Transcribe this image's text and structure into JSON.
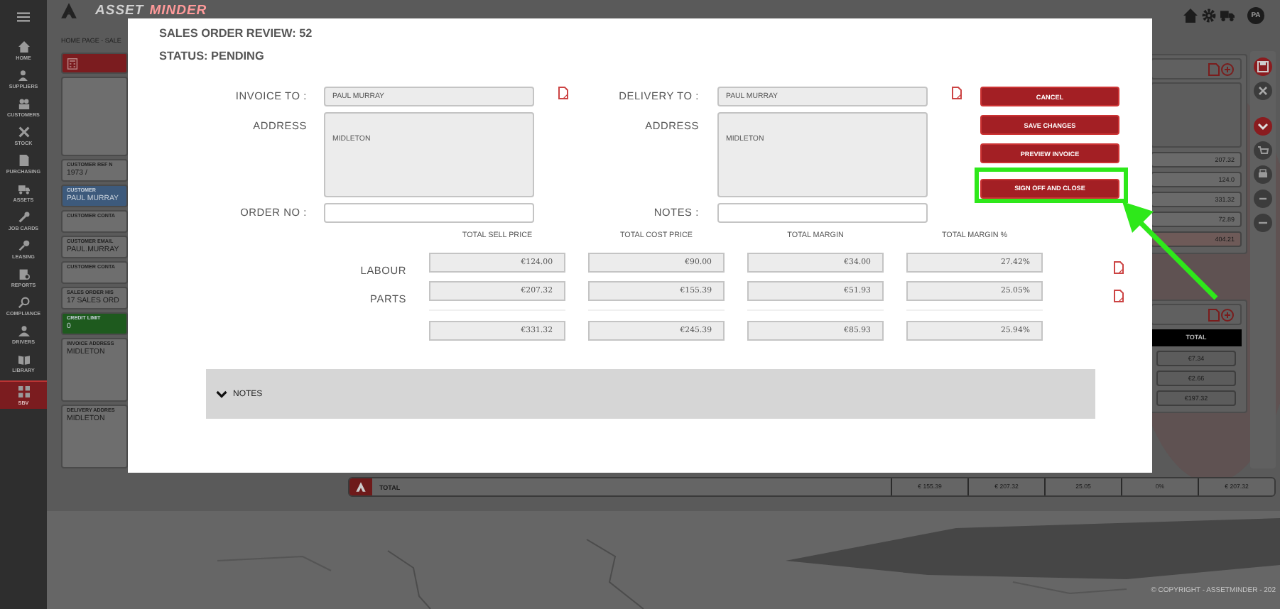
{
  "sidebar": {
    "items": [
      {
        "label": "HOME",
        "selected": false
      },
      {
        "label": "SUPPLIERS",
        "selected": false
      },
      {
        "label": "CUSTOMERS",
        "selected": false
      },
      {
        "label": "STOCK",
        "selected": false
      },
      {
        "label": "PURCHASING",
        "selected": false
      },
      {
        "label": "ASSETS",
        "selected": false
      },
      {
        "label": "JOB CARDS",
        "selected": false
      },
      {
        "label": "LEASING",
        "selected": false
      },
      {
        "label": "REPORTS",
        "selected": false
      },
      {
        "label": "COMPLIANCE",
        "selected": false
      },
      {
        "label": "DRIVERS",
        "selected": false
      },
      {
        "label": "LIBRARY",
        "selected": false
      },
      {
        "label": "SBV",
        "selected": true
      }
    ]
  },
  "header": {
    "logo_first": "ASSET",
    "logo_second": "MINDER",
    "user_initials": "PA"
  },
  "breadcrumb": "HOME PAGE - SALE",
  "customer_panel": {
    "cards": [
      {
        "kind": "icon",
        "color": "#7b1c1f"
      },
      {
        "kind": "blank",
        "color": "#6e6e6e"
      },
      {
        "kind": "field",
        "label": "CUSTOMER REF N",
        "value": "1973 /",
        "color": "#6e6e6e"
      },
      {
        "kind": "field",
        "label": "CUSTOMER",
        "value": "PAUL MURRAY",
        "color": "#3d5a7c"
      },
      {
        "kind": "field",
        "label": "CUSTOMER CONTA",
        "color": "#6e6e6e"
      },
      {
        "kind": "field",
        "label": "CUSTOMER EMAIL",
        "value": "PAUL.MURRAY",
        "color": "#6e6e6e"
      },
      {
        "kind": "field",
        "label": "CUSTOMER CONTA",
        "color": "#6e6e6e"
      },
      {
        "kind": "field",
        "label": "SALES ORDER HIS",
        "value": "17 SALES ORD",
        "color": "#6e6e6e"
      },
      {
        "kind": "field",
        "label": "CREDIT LIMIT",
        "value": "0",
        "color": "#1e5a1e"
      },
      {
        "kind": "address",
        "label": "INVOICE ADDRESS",
        "value": "MIDLETON",
        "color": "#6e6e6e"
      },
      {
        "kind": "address",
        "label": "DELIVERY ADDRES",
        "value": "MIDLETON",
        "color": "#6e6e6e"
      }
    ]
  },
  "summary_panel": {
    "values": [
      {
        "text": "207.32",
        "highlighted": false
      },
      {
        "text": "124.0",
        "highlighted": false
      },
      {
        "text": "331.32",
        "highlighted": false
      },
      {
        "text": "72.89",
        "highlighted": false
      },
      {
        "text": "404.21",
        "highlighted": true
      }
    ]
  },
  "lines_panel": {
    "column": "TOTAL",
    "values": [
      "€7.34",
      "€2.66",
      "€197.32"
    ]
  },
  "total_bar": {
    "label": "TOTAL",
    "values": [
      "€ 155.39",
      "€ 207.32",
      "25.05",
      "0%",
      "€ 207.32"
    ]
  },
  "copyright": "© COPYRIGHT - ASSETMINDER - 202",
  "modal": {
    "title": "SALES ORDER REVIEW: 52",
    "status": "STATUS: PENDING",
    "invoice_to": {
      "label": "INVOICE TO :",
      "value": "PAUL MURRAY"
    },
    "invoice_address": {
      "label": "ADDRESS",
      "value": "MIDLETON"
    },
    "order_no": {
      "label": "ORDER NO :"
    },
    "delivery_to": {
      "label": "DELIVERY TO :",
      "value": "PAUL MURRAY"
    },
    "delivery_address": {
      "label": "ADDRESS",
      "value": "MIDLETON"
    },
    "notes": {
      "label": "NOTES :"
    },
    "buttons": [
      {
        "label": "CANCEL",
        "highlighted": false
      },
      {
        "label": "SAVE CHANGES",
        "highlighted": false
      },
      {
        "label": "PREVIEW INVOICE",
        "highlighted": false
      },
      {
        "label": "SIGN OFF AND CLOSE",
        "highlighted": true
      }
    ],
    "totals": {
      "columns": [
        "TOTAL SELL PRICE",
        "TOTAL COST PRICE",
        "TOTAL MARGIN",
        "TOTAL MARGIN %"
      ],
      "rows": [
        {
          "kind": "line",
          "label": "LABOUR",
          "values": [
            "€124.00",
            "€90.00",
            "€34.00",
            "27.42%"
          ]
        },
        {
          "kind": "line",
          "label": "PARTS",
          "values": [
            "€207.32",
            "€155.39",
            "€51.93",
            "25.05%"
          ]
        },
        {
          "kind": "total",
          "values": [
            "€331.32",
            "€245.39",
            "€85.93",
            "25.94%"
          ]
        }
      ]
    },
    "notes_section": {
      "label": "NOTES",
      "expanded": false
    }
  }
}
